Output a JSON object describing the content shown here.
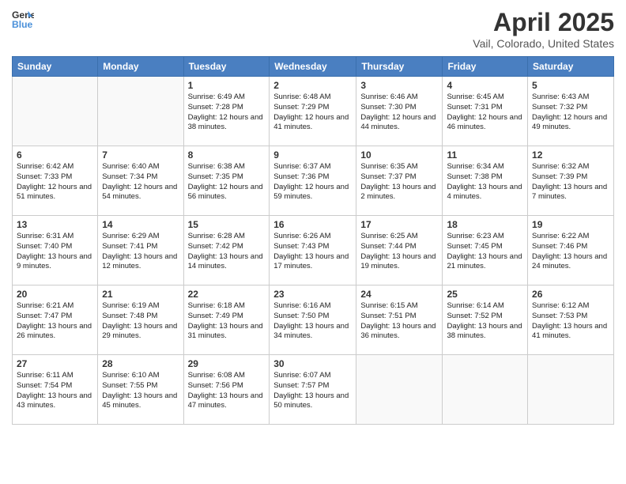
{
  "logo": {
    "line1": "General",
    "line2": "Blue"
  },
  "title": "April 2025",
  "location": "Vail, Colorado, United States",
  "days_of_week": [
    "Sunday",
    "Monday",
    "Tuesday",
    "Wednesday",
    "Thursday",
    "Friday",
    "Saturday"
  ],
  "weeks": [
    [
      {
        "num": "",
        "info": ""
      },
      {
        "num": "",
        "info": ""
      },
      {
        "num": "1",
        "info": "Sunrise: 6:49 AM\nSunset: 7:28 PM\nDaylight: 12 hours and 38 minutes."
      },
      {
        "num": "2",
        "info": "Sunrise: 6:48 AM\nSunset: 7:29 PM\nDaylight: 12 hours and 41 minutes."
      },
      {
        "num": "3",
        "info": "Sunrise: 6:46 AM\nSunset: 7:30 PM\nDaylight: 12 hours and 44 minutes."
      },
      {
        "num": "4",
        "info": "Sunrise: 6:45 AM\nSunset: 7:31 PM\nDaylight: 12 hours and 46 minutes."
      },
      {
        "num": "5",
        "info": "Sunrise: 6:43 AM\nSunset: 7:32 PM\nDaylight: 12 hours and 49 minutes."
      }
    ],
    [
      {
        "num": "6",
        "info": "Sunrise: 6:42 AM\nSunset: 7:33 PM\nDaylight: 12 hours and 51 minutes."
      },
      {
        "num": "7",
        "info": "Sunrise: 6:40 AM\nSunset: 7:34 PM\nDaylight: 12 hours and 54 minutes."
      },
      {
        "num": "8",
        "info": "Sunrise: 6:38 AM\nSunset: 7:35 PM\nDaylight: 12 hours and 56 minutes."
      },
      {
        "num": "9",
        "info": "Sunrise: 6:37 AM\nSunset: 7:36 PM\nDaylight: 12 hours and 59 minutes."
      },
      {
        "num": "10",
        "info": "Sunrise: 6:35 AM\nSunset: 7:37 PM\nDaylight: 13 hours and 2 minutes."
      },
      {
        "num": "11",
        "info": "Sunrise: 6:34 AM\nSunset: 7:38 PM\nDaylight: 13 hours and 4 minutes."
      },
      {
        "num": "12",
        "info": "Sunrise: 6:32 AM\nSunset: 7:39 PM\nDaylight: 13 hours and 7 minutes."
      }
    ],
    [
      {
        "num": "13",
        "info": "Sunrise: 6:31 AM\nSunset: 7:40 PM\nDaylight: 13 hours and 9 minutes."
      },
      {
        "num": "14",
        "info": "Sunrise: 6:29 AM\nSunset: 7:41 PM\nDaylight: 13 hours and 12 minutes."
      },
      {
        "num": "15",
        "info": "Sunrise: 6:28 AM\nSunset: 7:42 PM\nDaylight: 13 hours and 14 minutes."
      },
      {
        "num": "16",
        "info": "Sunrise: 6:26 AM\nSunset: 7:43 PM\nDaylight: 13 hours and 17 minutes."
      },
      {
        "num": "17",
        "info": "Sunrise: 6:25 AM\nSunset: 7:44 PM\nDaylight: 13 hours and 19 minutes."
      },
      {
        "num": "18",
        "info": "Sunrise: 6:23 AM\nSunset: 7:45 PM\nDaylight: 13 hours and 21 minutes."
      },
      {
        "num": "19",
        "info": "Sunrise: 6:22 AM\nSunset: 7:46 PM\nDaylight: 13 hours and 24 minutes."
      }
    ],
    [
      {
        "num": "20",
        "info": "Sunrise: 6:21 AM\nSunset: 7:47 PM\nDaylight: 13 hours and 26 minutes."
      },
      {
        "num": "21",
        "info": "Sunrise: 6:19 AM\nSunset: 7:48 PM\nDaylight: 13 hours and 29 minutes."
      },
      {
        "num": "22",
        "info": "Sunrise: 6:18 AM\nSunset: 7:49 PM\nDaylight: 13 hours and 31 minutes."
      },
      {
        "num": "23",
        "info": "Sunrise: 6:16 AM\nSunset: 7:50 PM\nDaylight: 13 hours and 34 minutes."
      },
      {
        "num": "24",
        "info": "Sunrise: 6:15 AM\nSunset: 7:51 PM\nDaylight: 13 hours and 36 minutes."
      },
      {
        "num": "25",
        "info": "Sunrise: 6:14 AM\nSunset: 7:52 PM\nDaylight: 13 hours and 38 minutes."
      },
      {
        "num": "26",
        "info": "Sunrise: 6:12 AM\nSunset: 7:53 PM\nDaylight: 13 hours and 41 minutes."
      }
    ],
    [
      {
        "num": "27",
        "info": "Sunrise: 6:11 AM\nSunset: 7:54 PM\nDaylight: 13 hours and 43 minutes."
      },
      {
        "num": "28",
        "info": "Sunrise: 6:10 AM\nSunset: 7:55 PM\nDaylight: 13 hours and 45 minutes."
      },
      {
        "num": "29",
        "info": "Sunrise: 6:08 AM\nSunset: 7:56 PM\nDaylight: 13 hours and 47 minutes."
      },
      {
        "num": "30",
        "info": "Sunrise: 6:07 AM\nSunset: 7:57 PM\nDaylight: 13 hours and 50 minutes."
      },
      {
        "num": "",
        "info": ""
      },
      {
        "num": "",
        "info": ""
      },
      {
        "num": "",
        "info": ""
      }
    ]
  ]
}
